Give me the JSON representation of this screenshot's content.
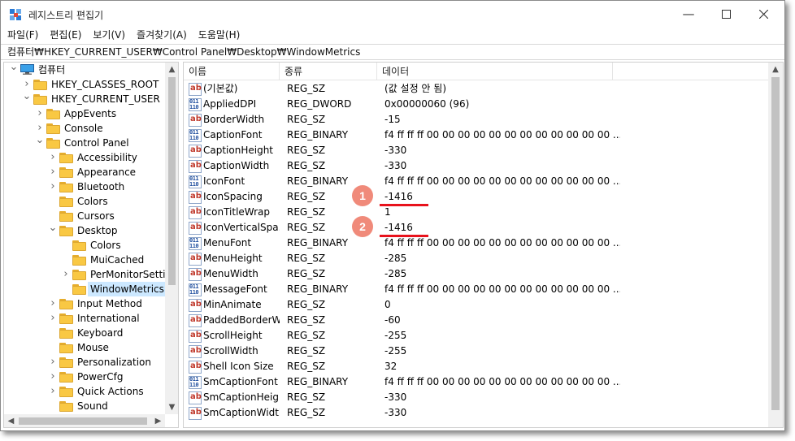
{
  "window": {
    "title": "레지스트리 편집기"
  },
  "menu": [
    "파일(F)",
    "편집(E)",
    "보기(V)",
    "즐겨찾기(A)",
    "도움말(H)"
  ],
  "address": "컴퓨터₩HKEY_CURRENT_USER₩Control Panel₩Desktop₩WindowMetrics",
  "tree": [
    {
      "label": "컴퓨터",
      "level": 0,
      "arrow": "down",
      "icon": "computer-icon"
    },
    {
      "label": "HKEY_CLASSES_ROOT",
      "level": 1,
      "arrow": "right",
      "icon": "folder-icon"
    },
    {
      "label": "HKEY_CURRENT_USER",
      "level": 1,
      "arrow": "down",
      "icon": "folder-icon"
    },
    {
      "label": "AppEvents",
      "level": 2,
      "arrow": "right",
      "icon": "folder-icon"
    },
    {
      "label": "Console",
      "level": 2,
      "arrow": "right",
      "icon": "folder-icon"
    },
    {
      "label": "Control Panel",
      "level": 2,
      "arrow": "down",
      "icon": "folder-icon"
    },
    {
      "label": "Accessibility",
      "level": 3,
      "arrow": "right",
      "icon": "folder-icon"
    },
    {
      "label": "Appearance",
      "level": 3,
      "arrow": "right",
      "icon": "folder-icon"
    },
    {
      "label": "Bluetooth",
      "level": 3,
      "arrow": "right",
      "icon": "folder-icon"
    },
    {
      "label": "Colors",
      "level": 3,
      "arrow": "",
      "icon": "folder-icon"
    },
    {
      "label": "Cursors",
      "level": 3,
      "arrow": "",
      "icon": "folder-icon"
    },
    {
      "label": "Desktop",
      "level": 3,
      "arrow": "down",
      "icon": "folder-icon"
    },
    {
      "label": "Colors",
      "level": 4,
      "arrow": "",
      "icon": "folder-icon"
    },
    {
      "label": "MuiCached",
      "level": 4,
      "arrow": "",
      "icon": "folder-icon"
    },
    {
      "label": "PerMonitorSettings",
      "level": 4,
      "arrow": "right",
      "icon": "folder-icon"
    },
    {
      "label": "WindowMetrics",
      "level": 4,
      "arrow": "",
      "icon": "folder-icon",
      "selected": true
    },
    {
      "label": "Input Method",
      "level": 3,
      "arrow": "right",
      "icon": "folder-icon"
    },
    {
      "label": "International",
      "level": 3,
      "arrow": "right",
      "icon": "folder-icon"
    },
    {
      "label": "Keyboard",
      "level": 3,
      "arrow": "",
      "icon": "folder-icon"
    },
    {
      "label": "Mouse",
      "level": 3,
      "arrow": "",
      "icon": "folder-icon"
    },
    {
      "label": "Personalization",
      "level": 3,
      "arrow": "right",
      "icon": "folder-icon"
    },
    {
      "label": "PowerCfg",
      "level": 3,
      "arrow": "right",
      "icon": "folder-icon"
    },
    {
      "label": "Quick Actions",
      "level": 3,
      "arrow": "right",
      "icon": "folder-icon"
    },
    {
      "label": "Sound",
      "level": 3,
      "arrow": "",
      "icon": "folder-icon"
    }
  ],
  "columns": [
    "이름",
    "종류",
    "데이터"
  ],
  "rows": [
    {
      "icon": "ab",
      "name": "(기본값)",
      "type": "REG_SZ",
      "data": "(값 설정 안 됨)"
    },
    {
      "icon": "bin",
      "name": "AppliedDPI",
      "type": "REG_DWORD",
      "data": "0x00000060 (96)"
    },
    {
      "icon": "ab",
      "name": "BorderWidth",
      "type": "REG_SZ",
      "data": "-15"
    },
    {
      "icon": "bin",
      "name": "CaptionFont",
      "type": "REG_BINARY",
      "data": "f4 ff ff ff 00 00 00 00 00 00 00 00 00 00 00 00 ..."
    },
    {
      "icon": "ab",
      "name": "CaptionHeight",
      "type": "REG_SZ",
      "data": "-330"
    },
    {
      "icon": "ab",
      "name": "CaptionWidth",
      "type": "REG_SZ",
      "data": "-330"
    },
    {
      "icon": "bin",
      "name": "IconFont",
      "type": "REG_BINARY",
      "data": "f4 ff ff ff 00 00 00 00 00 00 00 00 00 00 00 00 ..."
    },
    {
      "icon": "ab",
      "name": "IconSpacing",
      "type": "REG_SZ",
      "data": "-1416"
    },
    {
      "icon": "ab",
      "name": "IconTitleWrap",
      "type": "REG_SZ",
      "data": "1"
    },
    {
      "icon": "ab",
      "name": "IconVerticalSpa...",
      "type": "REG_SZ",
      "data": "-1416"
    },
    {
      "icon": "bin",
      "name": "MenuFont",
      "type": "REG_BINARY",
      "data": "f4 ff ff ff 00 00 00 00 00 00 00 00 00 00 00 00 ..."
    },
    {
      "icon": "ab",
      "name": "MenuHeight",
      "type": "REG_SZ",
      "data": "-285"
    },
    {
      "icon": "ab",
      "name": "MenuWidth",
      "type": "REG_SZ",
      "data": "-285"
    },
    {
      "icon": "bin",
      "name": "MessageFont",
      "type": "REG_BINARY",
      "data": "f4 ff ff ff 00 00 00 00 00 00 00 00 00 00 00 00 ..."
    },
    {
      "icon": "ab",
      "name": "MinAnimate",
      "type": "REG_SZ",
      "data": "0"
    },
    {
      "icon": "ab",
      "name": "PaddedBorderW...",
      "type": "REG_SZ",
      "data": "-60"
    },
    {
      "icon": "ab",
      "name": "ScrollHeight",
      "type": "REG_SZ",
      "data": "-255"
    },
    {
      "icon": "ab",
      "name": "ScrollWidth",
      "type": "REG_SZ",
      "data": "-255"
    },
    {
      "icon": "ab",
      "name": "Shell Icon Size",
      "type": "REG_SZ",
      "data": "32"
    },
    {
      "icon": "bin",
      "name": "SmCaptionFont",
      "type": "REG_BINARY",
      "data": "f4 ff ff ff 00 00 00 00 00 00 00 00 00 00 00 00 ..."
    },
    {
      "icon": "ab",
      "name": "SmCaptionHeight",
      "type": "REG_SZ",
      "data": "-330"
    },
    {
      "icon": "ab",
      "name": "SmCaptionWidth",
      "type": "REG_SZ",
      "data": "-330"
    }
  ],
  "annotations": [
    {
      "label": "1",
      "row": 7
    },
    {
      "label": "2",
      "row": 9
    }
  ],
  "colors": {
    "selection": "#cce8ff",
    "badge": "#f08a7a",
    "underline": "#e8121c",
    "folder": "#f9c843"
  }
}
